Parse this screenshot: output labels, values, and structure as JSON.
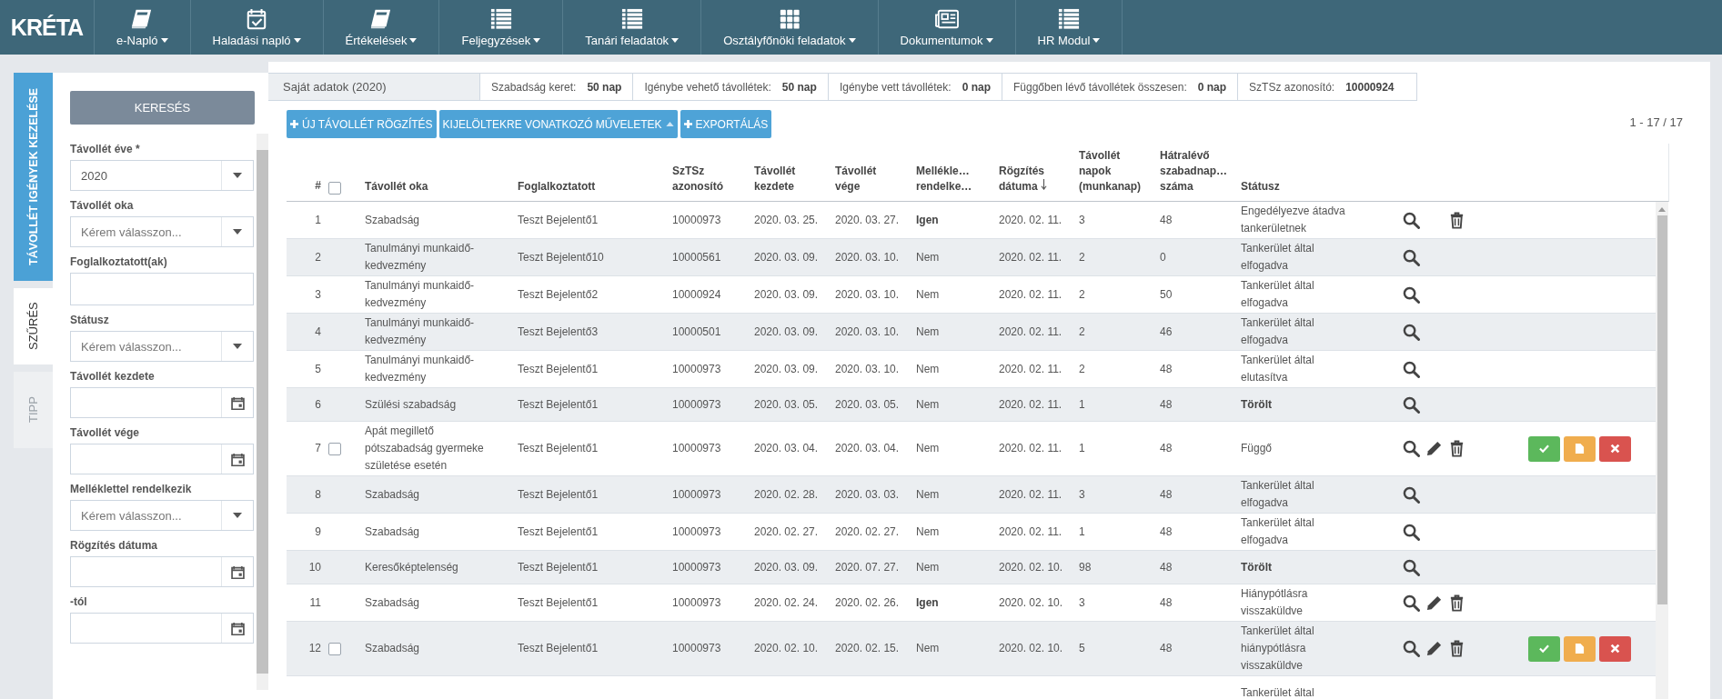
{
  "logo": "KRÉTA",
  "nav": [
    {
      "label": "e-Napló"
    },
    {
      "label": "Haladási napló"
    },
    {
      "label": "Értékelések"
    },
    {
      "label": "Feljegyzések"
    },
    {
      "label": "Tanári feladatok"
    },
    {
      "label": "Osztályfőnöki feladatok"
    },
    {
      "label": "Dokumentumok"
    },
    {
      "label": "HR Modul"
    }
  ],
  "side_tabs": [
    {
      "label": "TÁVOLLÉT IGÉNYEK KEZELÉSE",
      "selected": true,
      "disabled": false
    },
    {
      "label": "SZŰRÉS",
      "selected": false,
      "disabled": false
    },
    {
      "label": "TIPP",
      "selected": false,
      "disabled": true
    }
  ],
  "filter": {
    "search_button": "KERESÉS",
    "fields": [
      {
        "kind": "select",
        "label": "Távollét éve *",
        "value": "2020"
      },
      {
        "kind": "select",
        "label": "Távollét oka",
        "placeholder": "Kérem válasszon..."
      },
      {
        "kind": "text",
        "label": "Foglalkoztatott(ak)"
      },
      {
        "kind": "select",
        "label": "Státusz",
        "placeholder": "Kérem válasszon..."
      },
      {
        "kind": "date",
        "label": "Távollét kezdete"
      },
      {
        "kind": "date",
        "label": "Távollét vége"
      },
      {
        "kind": "select",
        "label": "Melléklettel rendelkezik",
        "placeholder": "Kérem válasszon..."
      },
      {
        "kind": "date",
        "label": "Rögzítés dátuma"
      },
      {
        "kind": "date",
        "label": "-tól"
      }
    ]
  },
  "summary": {
    "title": "Saját adatok (2020)",
    "items": [
      {
        "label": "Szabadság keret:",
        "value": "50 nap"
      },
      {
        "label": "Igénybe vehető távollétek:",
        "value": "50 nap"
      },
      {
        "label": "Igénybe vett távollétek:",
        "value": "0 nap"
      },
      {
        "label": "Függőben lévő távollétek összesen:",
        "value": "0 nap"
      },
      {
        "label": "SzTSz azonosító:",
        "value": "10000924"
      }
    ]
  },
  "toolbar": [
    {
      "label": "ÚJ TÁVOLLÉT RÖGZÍTÉS",
      "kind": "plus"
    },
    {
      "label": "KIJELÖLTEKRE VONATKOZÓ MŰVELETEK",
      "kind": "menu"
    },
    {
      "label": "EXPORTÁLÁS",
      "kind": "plus"
    }
  ],
  "pager": "1 - 17 / 17",
  "table": {
    "select_all": {
      "checked": false
    },
    "columns": [
      {
        "label": "#",
        "sorted": false
      },
      {
        "label": "Távollét oka",
        "sorted": false
      },
      {
        "label": "Foglalkoztatott",
        "sorted": false
      },
      {
        "label": "SzTSz azonosító",
        "sorted": false
      },
      {
        "label": "Távollét kezdete",
        "sorted": false
      },
      {
        "label": "Távollét vége",
        "sorted": false
      },
      {
        "label": "Mellékle… rendelke…",
        "sorted": false
      },
      {
        "label": "Rögzítés dátuma",
        "sorted": true
      },
      {
        "label": "Távollét napok (munkanap)",
        "sorted": false
      },
      {
        "label": "Hátralévő szabadnap… száma",
        "sorted": false
      },
      {
        "label": "Státusz",
        "sorted": false
      }
    ],
    "rows": [
      {
        "num": "1",
        "reason": "Szabadság",
        "employee": "Teszt Bejelentő1",
        "id": "10000973",
        "start": "2020. 03. 25.",
        "end": "2020. 03. 27.",
        "attachment": "Igen",
        "attachment_bold": true,
        "recorded": "2020. 02. 11.",
        "days": "3",
        "remaining": "48",
        "status": "Engedélyezve átadva tankerületnek",
        "status_bold": false,
        "view": true,
        "edit": false,
        "delete": true,
        "decisions": false
      },
      {
        "num": "2",
        "reason": "Tanulmányi munkaidő-kedvezmény",
        "employee": "Teszt Bejelentő10",
        "id": "10000561",
        "start": "2020. 03. 09.",
        "end": "2020. 03. 10.",
        "attachment": "Nem",
        "attachment_bold": false,
        "recorded": "2020. 02. 11.",
        "days": "2",
        "remaining": "0",
        "status": "Tankerület által elfogadva",
        "status_bold": false,
        "view": true,
        "edit": false,
        "delete": false,
        "decisions": false
      },
      {
        "num": "3",
        "reason": "Tanulmányi munkaidő-kedvezmény",
        "employee": "Teszt Bejelentő2",
        "id": "10000924",
        "start": "2020. 03. 09.",
        "end": "2020. 03. 10.",
        "attachment": "Nem",
        "attachment_bold": false,
        "recorded": "2020. 02. 11.",
        "days": "2",
        "remaining": "50",
        "status": "Tankerület által elfogadva",
        "status_bold": false,
        "view": true,
        "edit": false,
        "delete": false,
        "decisions": false
      },
      {
        "num": "4",
        "reason": "Tanulmányi munkaidő-kedvezmény",
        "employee": "Teszt Bejelentő3",
        "id": "10000501",
        "start": "2020. 03. 09.",
        "end": "2020. 03. 10.",
        "attachment": "Nem",
        "attachment_bold": false,
        "recorded": "2020. 02. 11.",
        "days": "2",
        "remaining": "46",
        "status": "Tankerület által elfogadva",
        "status_bold": false,
        "view": true,
        "edit": false,
        "delete": false,
        "decisions": false
      },
      {
        "num": "5",
        "reason": "Tanulmányi munkaidő-kedvezmény",
        "employee": "Teszt Bejelentő1",
        "id": "10000973",
        "start": "2020. 03. 09.",
        "end": "2020. 03. 10.",
        "attachment": "Nem",
        "attachment_bold": false,
        "recorded": "2020. 02. 11.",
        "days": "2",
        "remaining": "48",
        "status": "Tankerület által elutasítva",
        "status_bold": false,
        "view": true,
        "edit": false,
        "delete": false,
        "decisions": false
      },
      {
        "num": "6",
        "reason": "Szülési szabadság",
        "employee": "Teszt Bejelentő1",
        "id": "10000973",
        "start": "2020. 03. 05.",
        "end": "2020. 03. 05.",
        "attachment": "Nem",
        "attachment_bold": false,
        "recorded": "2020. 02. 11.",
        "days": "1",
        "remaining": "48",
        "status": "Törölt",
        "status_bold": true,
        "view": true,
        "edit": false,
        "delete": false,
        "decisions": false
      },
      {
        "num": "7",
        "checkbox": {
          "checked": false
        },
        "reason": "Apát megillető pótszabadság gyermeke születése esetén",
        "employee": "Teszt Bejelentő1",
        "id": "10000973",
        "start": "2020. 03. 04.",
        "end": "2020. 03. 04.",
        "attachment": "Nem",
        "attachment_bold": false,
        "recorded": "2020. 02. 11.",
        "days": "1",
        "remaining": "48",
        "status": "Függő",
        "status_bold": false,
        "view": true,
        "edit": true,
        "delete": true,
        "decisions": true
      },
      {
        "num": "8",
        "reason": "Szabadság",
        "employee": "Teszt Bejelentő1",
        "id": "10000973",
        "start": "2020. 02. 28.",
        "end": "2020. 03. 03.",
        "attachment": "Nem",
        "attachment_bold": false,
        "recorded": "2020. 02. 11.",
        "days": "3",
        "remaining": "48",
        "status": "Tankerület által elfogadva",
        "status_bold": false,
        "view": true,
        "edit": false,
        "delete": false,
        "decisions": false
      },
      {
        "num": "9",
        "reason": "Szabadság",
        "employee": "Teszt Bejelentő1",
        "id": "10000973",
        "start": "2020. 02. 27.",
        "end": "2020. 02. 27.",
        "attachment": "Nem",
        "attachment_bold": false,
        "recorded": "2020. 02. 11.",
        "days": "1",
        "remaining": "48",
        "status": "Tankerület által elfogadva",
        "status_bold": false,
        "view": true,
        "edit": false,
        "delete": false,
        "decisions": false
      },
      {
        "num": "10",
        "reason": "Keresőképtelenség",
        "employee": "Teszt Bejelentő1",
        "id": "10000973",
        "start": "2020. 03. 09.",
        "end": "2020. 07. 27.",
        "attachment": "Nem",
        "attachment_bold": false,
        "recorded": "2020. 02. 10.",
        "days": "98",
        "remaining": "48",
        "status": "Törölt",
        "status_bold": true,
        "view": true,
        "edit": false,
        "delete": false,
        "decisions": false
      },
      {
        "num": "11",
        "reason": "Szabadság",
        "employee": "Teszt Bejelentő1",
        "id": "10000973",
        "start": "2020. 02. 24.",
        "end": "2020. 02. 26.",
        "attachment": "Igen",
        "attachment_bold": true,
        "recorded": "2020. 02. 10.",
        "days": "3",
        "remaining": "48",
        "status": "Hiánypótlásra visszaküldve",
        "status_bold": false,
        "view": true,
        "edit": true,
        "delete": true,
        "decisions": false
      },
      {
        "num": "12",
        "checkbox": {
          "checked": false
        },
        "reason": "Szabadság",
        "employee": "Teszt Bejelentő1",
        "id": "10000973",
        "start": "2020. 02. 10.",
        "end": "2020. 02. 15.",
        "attachment": "Nem",
        "attachment_bold": false,
        "recorded": "2020. 02. 10.",
        "days": "5",
        "remaining": "48",
        "status": "Tankerület által hiánypótlásra visszaküldve",
        "status_bold": false,
        "view": true,
        "edit": true,
        "delete": true,
        "decisions": true
      },
      {
        "status": "Tankerület által",
        "status_bold": false,
        "view": false,
        "edit": false,
        "delete": false,
        "decisions": false
      }
    ]
  }
}
